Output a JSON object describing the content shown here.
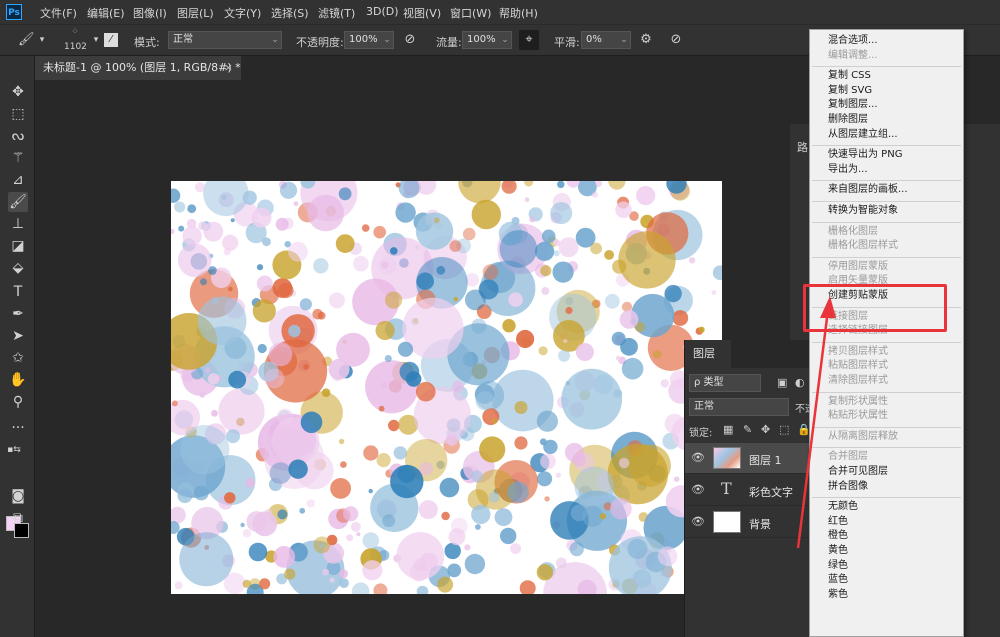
{
  "app": {
    "logo": "Ps"
  },
  "menu": [
    "文件(F)",
    "编辑(E)",
    "图像(I)",
    "图层(L)",
    "文字(Y)",
    "选择(S)",
    "滤镜(T)",
    "3D(D)",
    "视图(V)",
    "窗口(W)",
    "帮助(H)"
  ],
  "options": {
    "brush_size": "1102",
    "mode_label": "模式:",
    "mode_value": "正常",
    "opacity_label": "不透明度:",
    "opacity_value": "100%",
    "flow_label": "流量:",
    "flow_value": "100%",
    "smooth_label": "平滑:",
    "smooth_value": "0%"
  },
  "document_tab": {
    "title": "未标题-1 @ 100% (图层 1, RGB/8#) *",
    "close": "×"
  },
  "colors": {
    "foreground": "#f3d3f3",
    "background": "#000000",
    "highlight": "#e8343a"
  },
  "side_panel": {
    "tab_partial": "路"
  },
  "layers_panel": {
    "tab": "图层",
    "filter_label": "ρ 类型",
    "blend_mode": "正常",
    "opacity_partial": "不透",
    "lock_label": "锁定:",
    "layers": [
      {
        "name": "图层 1",
        "selected": true,
        "kind": "pixel"
      },
      {
        "name": "彩色文字",
        "selected": false,
        "kind": "text",
        "thumb_glyph": "T"
      },
      {
        "name": "背景",
        "selected": false,
        "kind": "background"
      }
    ]
  },
  "context_menu": {
    "items": [
      {
        "label": "混合选项...",
        "enabled": true
      },
      {
        "label": "编辑调整...",
        "enabled": false
      },
      {
        "sep": true
      },
      {
        "label": "复制 CSS",
        "enabled": true
      },
      {
        "label": "复制 SVG",
        "enabled": true
      },
      {
        "label": "复制图层...",
        "enabled": true
      },
      {
        "label": "删除图层",
        "enabled": true
      },
      {
        "label": "从图层建立组...",
        "enabled": true
      },
      {
        "sep": true
      },
      {
        "label": "快速导出为 PNG",
        "enabled": true
      },
      {
        "label": "导出为...",
        "enabled": true
      },
      {
        "sep": true
      },
      {
        "label": "来自图层的画板...",
        "enabled": true
      },
      {
        "sep": true
      },
      {
        "label": "转换为智能对象",
        "enabled": true
      },
      {
        "sep": true
      },
      {
        "label": "栅格化图层",
        "enabled": false
      },
      {
        "label": "栅格化图层样式",
        "enabled": false
      },
      {
        "sep": true
      },
      {
        "label": "停用图层蒙版",
        "enabled": false
      },
      {
        "label": "启用矢量蒙版",
        "enabled": false
      },
      {
        "label": "创建剪贴蒙版",
        "enabled": true
      },
      {
        "sep": true
      },
      {
        "label": "链接图层",
        "enabled": false
      },
      {
        "label": "选择链接图层",
        "enabled": false
      },
      {
        "sep": true
      },
      {
        "label": "拷贝图层样式",
        "enabled": false
      },
      {
        "label": "粘贴图层样式",
        "enabled": false
      },
      {
        "label": "清除图层样式",
        "enabled": false
      },
      {
        "sep": true
      },
      {
        "label": "复制形状属性",
        "enabled": false
      },
      {
        "label": "粘贴形状属性",
        "enabled": false
      },
      {
        "sep": true
      },
      {
        "label": "从隔离图层释放",
        "enabled": false
      },
      {
        "sep": true
      },
      {
        "label": "合并图层",
        "enabled": false
      },
      {
        "label": "合并可见图层",
        "enabled": true
      },
      {
        "label": "拼合图像",
        "enabled": true
      },
      {
        "sep": true
      },
      {
        "label": "无颜色",
        "enabled": true
      },
      {
        "label": "红色",
        "enabled": true
      },
      {
        "label": "橙色",
        "enabled": true
      },
      {
        "label": "黄色",
        "enabled": true
      },
      {
        "label": "绿色",
        "enabled": true
      },
      {
        "label": "蓝色",
        "enabled": true
      },
      {
        "label": "紫色",
        "enabled": true
      }
    ]
  }
}
